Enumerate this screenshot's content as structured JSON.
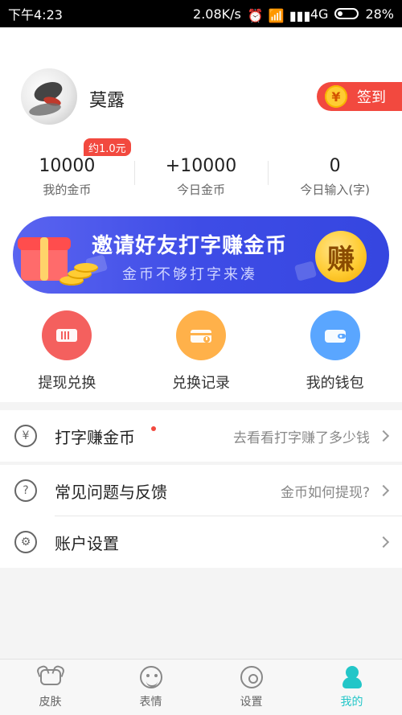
{
  "status_bar": {
    "time": "下午4:23",
    "network_speed": "2.08K/s",
    "network_type": "4G",
    "battery": "28%"
  },
  "profile": {
    "username": "莫露",
    "signin_label": "签到",
    "coin_symbol": "¥"
  },
  "stats": {
    "hint": "约1.0元",
    "items": [
      {
        "value": "10000",
        "label": "我的金币"
      },
      {
        "value": "+10000",
        "label": "今日金币"
      },
      {
        "value": "0",
        "label": "今日输入(字)"
      }
    ]
  },
  "banner": {
    "title": "邀请好友打字赚金币",
    "subtitle": "金币不够打字来凑",
    "badge": "赚"
  },
  "actions": [
    {
      "label": "提现兑换"
    },
    {
      "label": "兑换记录"
    },
    {
      "label": "我的钱包"
    }
  ],
  "list": {
    "typing": {
      "title": "打字赚金币",
      "subtitle": "去看看打字赚了多少钱"
    },
    "faq": {
      "title": "常见问题与反馈",
      "subtitle": "金币如何提现?"
    },
    "account": {
      "title": "账户设置",
      "subtitle": ""
    }
  },
  "nav": [
    {
      "label": "皮肤"
    },
    {
      "label": "表情"
    },
    {
      "label": "设置"
    },
    {
      "label": "我的"
    }
  ],
  "colors": {
    "accent": "#23c6c8",
    "signin_red": "#f2493f",
    "banner_blue": "#3e4ce6"
  }
}
